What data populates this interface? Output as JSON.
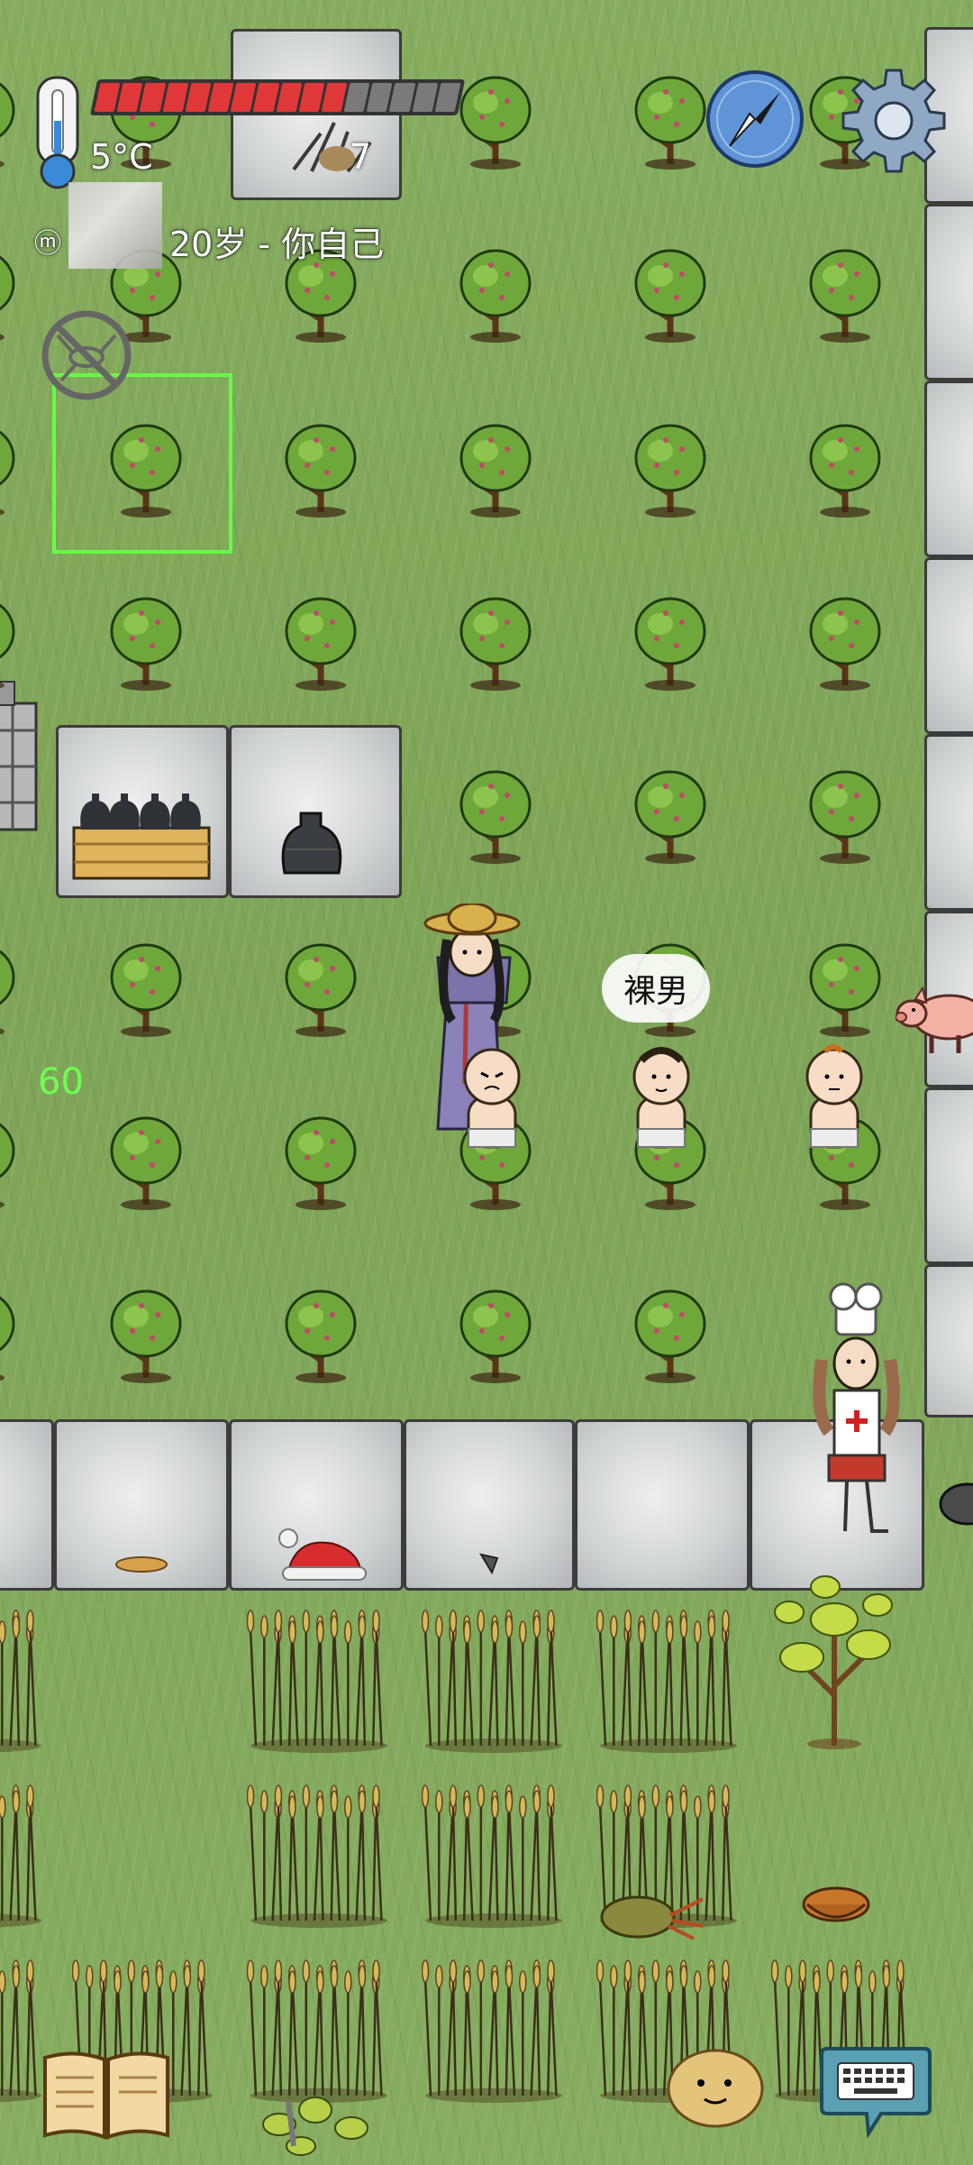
{
  "hud": {
    "temperature": "5°C",
    "health_segments_total": 16,
    "health_segments_filled": 11,
    "player_age_label": "20岁 - 你自己",
    "stack_count": "7",
    "counter": "60"
  },
  "speech": {
    "text": "裸男"
  },
  "icons": {
    "thermometer": "thermometer-icon",
    "compass": "compass-icon",
    "settings": "gear-icon",
    "disease": "no-mosquito-icon",
    "family": "family-tree-icon",
    "recipe_book": "book-icon",
    "emote": "potato-face-icon",
    "chat": "keyboard-icon"
  },
  "colors": {
    "health_filled": "#e03838",
    "health_empty": "#7a7a7a",
    "selection": "#63ff46",
    "counter": "#6dff52"
  }
}
